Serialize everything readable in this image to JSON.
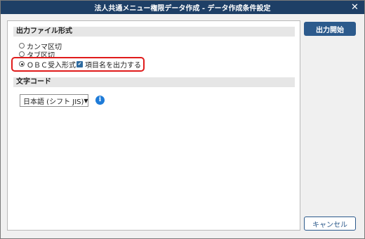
{
  "window": {
    "title": "法人共通メニュー権限データ作成 - データ作成条件設定",
    "close_icon": "close-icon"
  },
  "output_format": {
    "header": "出力ファイル形式",
    "options": [
      {
        "label": "カンマ区切",
        "selected": false
      },
      {
        "label": "タブ区切",
        "selected": false
      },
      {
        "label": "ＯＢＣ受入形式",
        "selected": true
      }
    ],
    "output_item_names": {
      "label": "項目名を出力する",
      "checked": true
    }
  },
  "encoding": {
    "header": "文字コード",
    "selected": "日本語 (シフト JIS)",
    "info_icon": "info-icon"
  },
  "buttons": {
    "start": "出力開始",
    "cancel": "キャンセル"
  },
  "colors": {
    "titlebar": "#1e3f66",
    "primary": "#2c5a8c",
    "highlight": "#e01c1c",
    "info": "#1e7bd8"
  }
}
